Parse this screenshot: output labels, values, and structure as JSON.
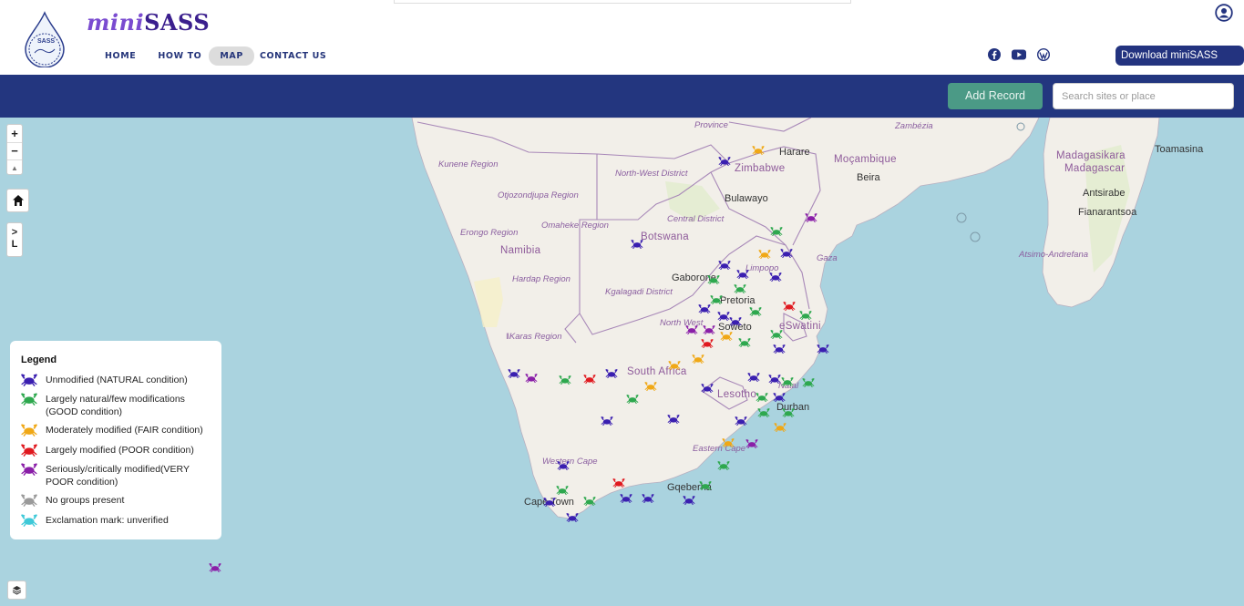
{
  "header": {
    "brand_mini": "mini",
    "brand_sass": "SASS",
    "logo_text": "SASS",
    "nav": [
      "HOME",
      "HOW TO",
      "MAP",
      "CONTACT US"
    ],
    "active_nav": "MAP",
    "download_label": "Download miniSASS App",
    "social_icons": [
      "facebook-icon",
      "youtube-icon",
      "wordpress-icon"
    ]
  },
  "toolbar": {
    "add_record_label": "Add Record",
    "search_placeholder": "Search sites or place"
  },
  "map": {
    "controls": {
      "zoom_in": "+",
      "zoom_out": "−",
      "reset": "▲",
      "home": "⌂",
      "expand": ">",
      "expand_letter": "L"
    },
    "countries": [
      "Namibia",
      "Botswana",
      "Zimbabwe",
      "Moçambique",
      "South Africa",
      "Lesotho",
      "eSwatini",
      "Madagasikara",
      "Madagascar"
    ],
    "cities": [
      "Harare",
      "Bulawayo",
      "Beira",
      "Gaborone",
      "Pretoria",
      "Soweto",
      "Durban",
      "Cape Town",
      "Gqeberha",
      "Antsirabe",
      "Fianarantsoa",
      "Toamasina"
    ],
    "regions": [
      "Kunene Region",
      "Otjozondjupa Region",
      "Omaheke Region",
      "Erongo Region",
      "Hardap Region",
      "ǁKaras Region",
      "North-West District",
      "Central District",
      "Kgalagadi District",
      "North West",
      "Western Cape",
      "Eastern Cape",
      "Limpopo",
      "Natal",
      "Gaza",
      "Zambézia",
      "Province",
      "Atsimo-Andrefana"
    ],
    "colors": {
      "water": "#aad3df",
      "land": "#f2efe9",
      "border": "#a888b8"
    }
  },
  "legend": {
    "title": "Legend",
    "items": [
      {
        "label": "Unmodified (NATURAL condition)",
        "color": "#3a1fb0"
      },
      {
        "label": "Largely natural/few modifications (GOOD condition)",
        "color": "#2ea84e"
      },
      {
        "label": "Moderately modified (FAIR condition)",
        "color": "#f0a816"
      },
      {
        "label": "Largely modified (POOR condition)",
        "color": "#e0191f"
      },
      {
        "label": "Seriously/critically modified(VERY POOR condition)",
        "color": "#8a1fa8"
      },
      {
        "label": "No groups present",
        "color": "#9a9a9a"
      },
      {
        "label": "Exclamation mark: unverified",
        "color": "#3fc9d8"
      }
    ]
  }
}
